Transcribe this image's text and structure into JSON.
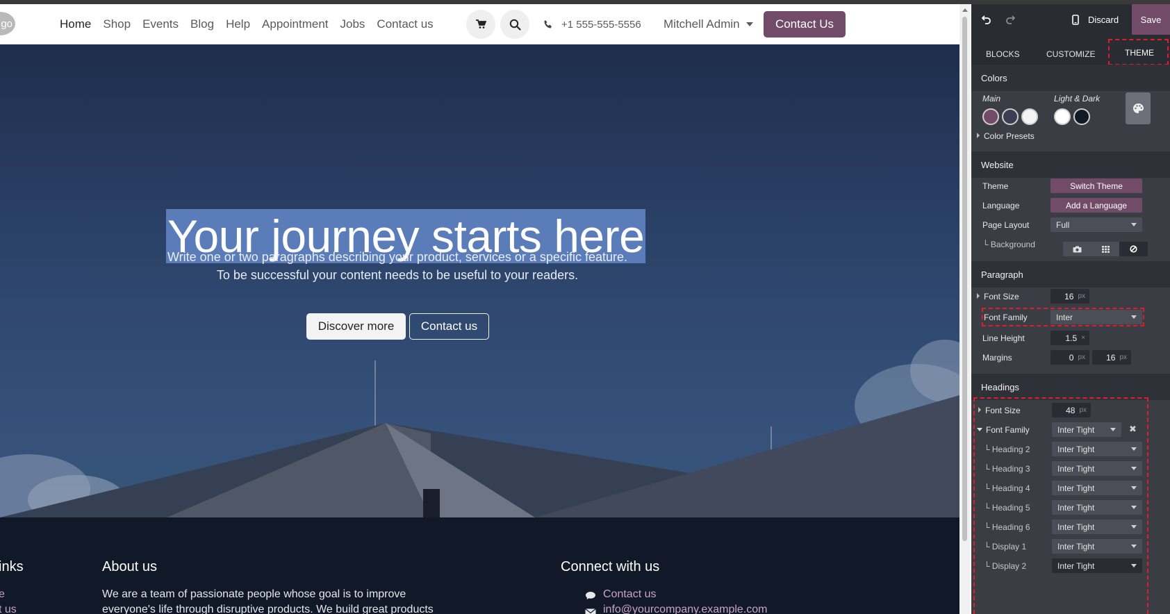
{
  "site": {
    "logo_text": "go",
    "nav": [
      {
        "label": "Home"
      },
      {
        "label": "Shop"
      },
      {
        "label": "Events"
      },
      {
        "label": "Blog"
      },
      {
        "label": "Help"
      },
      {
        "label": "Appointment"
      },
      {
        "label": "Jobs"
      },
      {
        "label": "Contact us"
      }
    ],
    "phone": "+1 555-555-5556",
    "user": "Mitchell Admin",
    "cta": "Contact Us"
  },
  "hero": {
    "title": "Your journey starts here",
    "para1": "Write one or two paragraphs describing your product, services or a specific feature.",
    "para2": "To be successful your content needs to be useful to your readers.",
    "btn_primary": "Discover more",
    "btn_secondary": "Contact us"
  },
  "footer": {
    "links_head": "inks",
    "link1": "e",
    "link2": "t us",
    "about_head": "About us",
    "about_line1": "We are a team of passionate people whose goal is to improve",
    "about_line2": "everyone's life through disruptive products. We build great products",
    "connect_head": "Connect with us",
    "contact_link": "Contact us",
    "email_link": "info@yourcompany.example.com"
  },
  "panel": {
    "discard": "Discard",
    "save": "Save",
    "tabs": {
      "blocks": "BLOCKS",
      "customize": "CUSTOMIZE",
      "theme": "THEME"
    },
    "colors": {
      "head": "Colors",
      "main_label": "Main",
      "light_dark_label": "Light & Dark",
      "presets": "Color Presets",
      "main": [
        "#714b67",
        "#3b3d52",
        "#f3f3f3"
      ],
      "light_dark": [
        "#ffffff",
        "#111827"
      ]
    },
    "website": {
      "head": "Website",
      "theme_label": "Theme",
      "theme_btn": "Switch Theme",
      "language_label": "Language",
      "language_btn": "Add a Language",
      "layout_label": "Page Layout",
      "layout_value": "Full",
      "background_label": "└ Background"
    },
    "paragraph": {
      "head": "Paragraph",
      "font_size_label": "Font Size",
      "font_size": "16",
      "font_family_label": "Font Family",
      "font_family": "Inter",
      "line_height_label": "Line Height",
      "line_height": "1.5",
      "line_height_unit": "×",
      "margins_label": "Margins",
      "margin_top": "0",
      "margin_bottom": "16",
      "unit": "px"
    },
    "headings": {
      "head": "Headings",
      "font_size_label": "Font Size",
      "font_size": "48",
      "font_family_label": "Font Family",
      "font_family": "Inter Tight",
      "items": [
        {
          "label": "└ Heading 2",
          "value": "Inter Tight"
        },
        {
          "label": "└ Heading 3",
          "value": "Inter Tight"
        },
        {
          "label": "└ Heading 4",
          "value": "Inter Tight"
        },
        {
          "label": "└ Heading 5",
          "value": "Inter Tight"
        },
        {
          "label": "└ Heading 6",
          "value": "Inter Tight"
        },
        {
          "label": "└ Display 1",
          "value": "Inter Tight"
        },
        {
          "label": "└ Display 2",
          "value": "Inter Tight"
        }
      ]
    }
  }
}
